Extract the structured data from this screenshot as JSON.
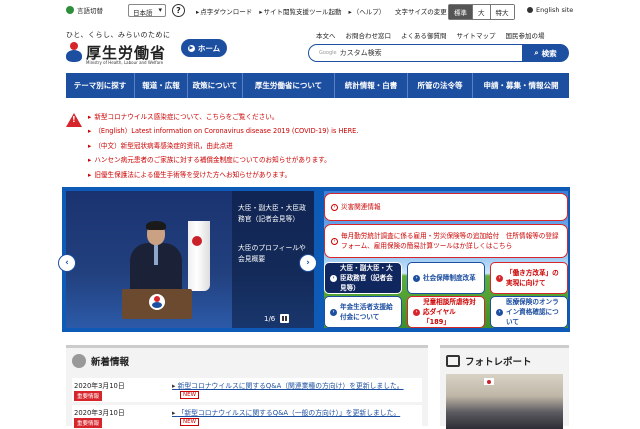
{
  "util": {
    "lang_switch": "言語切替",
    "lang_select": "日本語",
    "links": [
      "点字ダウンロード",
      "サイト閲覧支援ツール起動",
      "（ヘルプ）"
    ],
    "fontsize_label": "文字サイズの変更",
    "fontsize": [
      "標準",
      "大",
      "特大"
    ],
    "english": "English site"
  },
  "header": {
    "tagline": "ひと、くらし、みらいのために",
    "logo": "厚生労働省",
    "logo_sub": "Ministry of Health, Labour and Welfare",
    "home": "ホーム",
    "links": [
      "本文へ",
      "お問合わせ窓口",
      "よくある御質問",
      "サイトマップ",
      "国民参加の場"
    ],
    "search_placeholder": "カスタム検索",
    "search_brand": "Google",
    "search_button": "検索"
  },
  "nav": [
    "テーマ別に探す",
    "報道・広報",
    "政策について",
    "厚生労働省について",
    "統計情報・白書",
    "所管の法令等",
    "申請・募集・情報公開"
  ],
  "alerts": [
    "新型コロナウイルス感染症について、こちらをご覧ください。",
    "（English）Latest information on Coronavirus disease 2019 (COVID-19) is HERE.",
    "（中文）新型冠状病毒感染症的资讯，由此点进",
    "ハンセン病元患者のご家族に対する補償金制度についてのお知らせがあります。",
    "旧優生保護法による優生手術等を受けた方へお知らせがあります。"
  ],
  "hero": {
    "caption": "大臣・副大臣・大臣政務官（記者会見等）",
    "caption2": "大臣のプロフィールや会見概要",
    "counter": "1/6"
  },
  "pickup": {
    "p1": "災害関連情報",
    "p2": "毎月勤労統計調査に係る雇用・労災保険等の追加給付　住所情報等の登録フォーム、雇用保険の簡易計算ツールほか詳しくはこちら",
    "tiles": [
      "大臣・副大臣・大臣政務官（記者会見等）",
      "社会保障制度改革",
      "「働き方改革」の実現に向けて",
      "年金生活者支援給付金について",
      "児童相談所虐待対応ダイヤル「189」",
      "医療保険のオンライン資格確認について"
    ]
  },
  "news": {
    "title": "新着情報",
    "items": [
      {
        "date": "2020年3月10日",
        "tag": "重要情報",
        "title": "新型コロナウイルスに関するQ&A（関連業種の方向け）を更新しました。",
        "new": "NEW"
      },
      {
        "date": "2020年3月10日",
        "tag": "重要情報",
        "title": "「新型コロナウイルスに関するQ&A（一般の方向け）」を更新しました。",
        "new": "NEW"
      }
    ]
  },
  "photo": {
    "title": "フォトレポート"
  }
}
